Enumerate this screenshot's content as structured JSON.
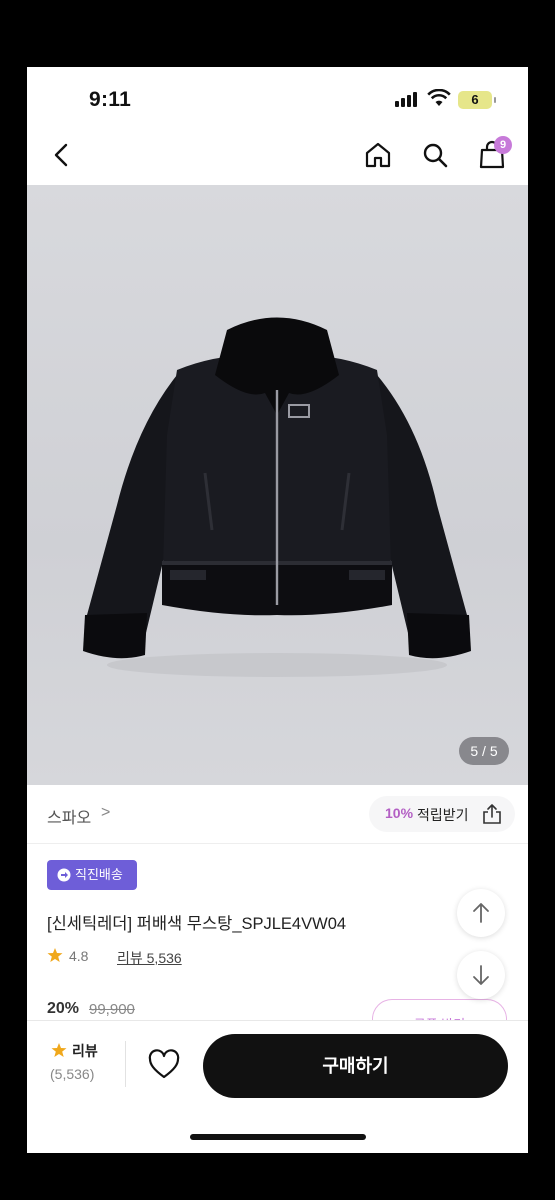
{
  "status": {
    "time": "9:11",
    "battery": "6"
  },
  "nav": {
    "cart_badge": "9"
  },
  "gallery": {
    "counter": "5 / 5"
  },
  "brand": {
    "name": "스파오",
    "arrow": ">"
  },
  "points": {
    "percent": "10%",
    "label": "적립받기"
  },
  "tag": {
    "label": "직진배송"
  },
  "product": {
    "name": "[신세틱레더] 퍼배색 무스탕_SPJLE4VW04"
  },
  "rating": {
    "value": "4.8",
    "review_text": "리뷰 5,536"
  },
  "price": {
    "discount": "20%",
    "original": "99,900"
  },
  "coupon": {
    "label": "쿠폰 받기"
  },
  "bottom_bar": {
    "review_label": "리뷰",
    "review_count": "(5,536)",
    "buy_label": "구매하기"
  },
  "colors": {
    "accent": "#c77ad9",
    "tag_bg": "#6e5ed8",
    "buy_bg": "#111111",
    "star": "#f0a81c"
  },
  "icons": [
    "back-icon",
    "home-icon",
    "search-icon",
    "cart-icon",
    "share-icon",
    "truck-icon",
    "star-icon",
    "arrow-up-icon",
    "arrow-down-icon",
    "heart-icon"
  ]
}
